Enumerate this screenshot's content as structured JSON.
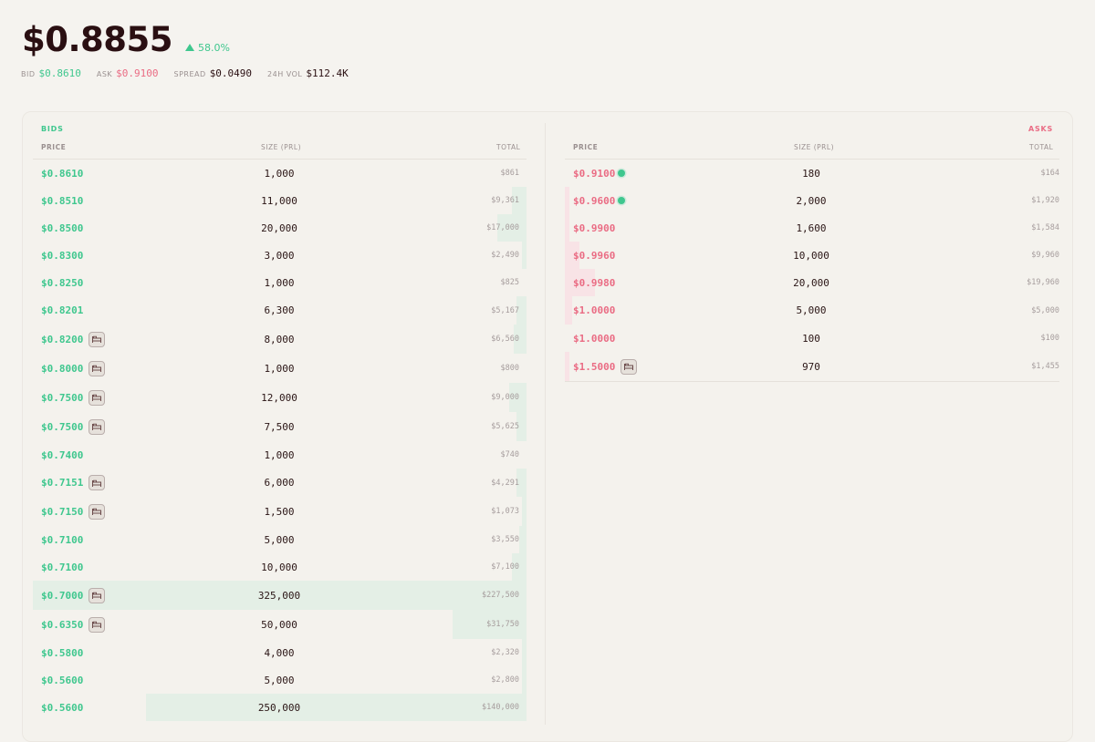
{
  "header": {
    "price": "$0.8855",
    "change": "58.0%",
    "bid_label": "BID",
    "bid": "$0.8610",
    "ask_label": "ASK",
    "ask": "$0.9100",
    "spread_label": "SPREAD",
    "spread": "$0.0490",
    "vol_label": "24H VOL",
    "vol": "$112.4K"
  },
  "bids": {
    "title": "BIDS",
    "col_price": "PRICE",
    "col_size": "SIZE (PRL)",
    "col_total": "TOTAL",
    "rows": [
      {
        "price": "$0.8610",
        "size": "1,000",
        "total": "$861",
        "depth": 0.0,
        "icon": false
      },
      {
        "price": "$0.8510",
        "size": "11,000",
        "total": "$9,361",
        "depth": 0.03,
        "icon": false
      },
      {
        "price": "$0.8500",
        "size": "20,000",
        "total": "$17,000",
        "depth": 0.06,
        "icon": false
      },
      {
        "price": "$0.8300",
        "size": "3,000",
        "total": "$2,490",
        "depth": 0.01,
        "icon": false
      },
      {
        "price": "$0.8250",
        "size": "1,000",
        "total": "$825",
        "depth": 0.0,
        "icon": false
      },
      {
        "price": "$0.8201",
        "size": "6,300",
        "total": "$5,167",
        "depth": 0.02,
        "icon": false
      },
      {
        "price": "$0.8200",
        "size": "8,000",
        "total": "$6,560",
        "depth": 0.025,
        "icon": true
      },
      {
        "price": "$0.8000",
        "size": "1,000",
        "total": "$800",
        "depth": 0.0,
        "icon": true
      },
      {
        "price": "$0.7500",
        "size": "12,000",
        "total": "$9,000",
        "depth": 0.035,
        "icon": true
      },
      {
        "price": "$0.7500",
        "size": "7,500",
        "total": "$5,625",
        "depth": 0.02,
        "icon": true
      },
      {
        "price": "$0.7400",
        "size": "1,000",
        "total": "$740",
        "depth": 0.0,
        "icon": false
      },
      {
        "price": "$0.7151",
        "size": "6,000",
        "total": "$4,291",
        "depth": 0.02,
        "icon": true
      },
      {
        "price": "$0.7150",
        "size": "1,500",
        "total": "$1,073",
        "depth": 0.005,
        "icon": true
      },
      {
        "price": "$0.7100",
        "size": "5,000",
        "total": "$3,550",
        "depth": 0.015,
        "icon": false
      },
      {
        "price": "$0.7100",
        "size": "10,000",
        "total": "$7,100",
        "depth": 0.03,
        "icon": false
      },
      {
        "price": "$0.7000",
        "size": "325,000",
        "total": "$227,500",
        "depth": 1.0,
        "icon": true
      },
      {
        "price": "$0.6350",
        "size": "50,000",
        "total": "$31,750",
        "depth": 0.15,
        "icon": true
      },
      {
        "price": "$0.5800",
        "size": "4,000",
        "total": "$2,320",
        "depth": 0.01,
        "icon": false
      },
      {
        "price": "$0.5600",
        "size": "5,000",
        "total": "$2,800",
        "depth": 0.01,
        "icon": false
      },
      {
        "price": "$0.5600",
        "size": "250,000",
        "total": "$140,000",
        "depth": 0.77,
        "icon": false
      }
    ]
  },
  "asks": {
    "title": "ASKS",
    "col_price": "PRICE",
    "col_size": "SIZE (PRL)",
    "col_total": "TOTAL",
    "rows": [
      {
        "price": "$0.9100",
        "size": "180",
        "total": "$164",
        "depth": 0.0,
        "icon": false,
        "dot": true
      },
      {
        "price": "$0.9600",
        "size": "2,000",
        "total": "$1,920",
        "depth": 0.01,
        "icon": false,
        "dot": true
      },
      {
        "price": "$0.9900",
        "size": "1,600",
        "total": "$1,584",
        "depth": 0.01,
        "icon": false,
        "dot": false
      },
      {
        "price": "$0.9960",
        "size": "10,000",
        "total": "$9,960",
        "depth": 0.03,
        "icon": false,
        "dot": false
      },
      {
        "price": "$0.9980",
        "size": "20,000",
        "total": "$19,960",
        "depth": 0.06,
        "icon": false,
        "dot": false
      },
      {
        "price": "$1.0000",
        "size": "5,000",
        "total": "$5,000",
        "depth": 0.015,
        "icon": false,
        "dot": false
      },
      {
        "price": "$1.0000",
        "size": "100",
        "total": "$100",
        "depth": 0.0,
        "icon": false,
        "dot": false
      },
      {
        "price": "$1.5000",
        "size": "970",
        "total": "$1,455",
        "depth": 0.005,
        "icon": true,
        "dot": false
      }
    ]
  },
  "colors": {
    "bid": "#3fc78e",
    "ask": "#ea6c84",
    "bid_bar": "#e4efe6",
    "ask_bar": "#f8e3e6"
  },
  "icons": {
    "row_badge": "bed-icon",
    "fill_marker": "dot-indicator"
  }
}
